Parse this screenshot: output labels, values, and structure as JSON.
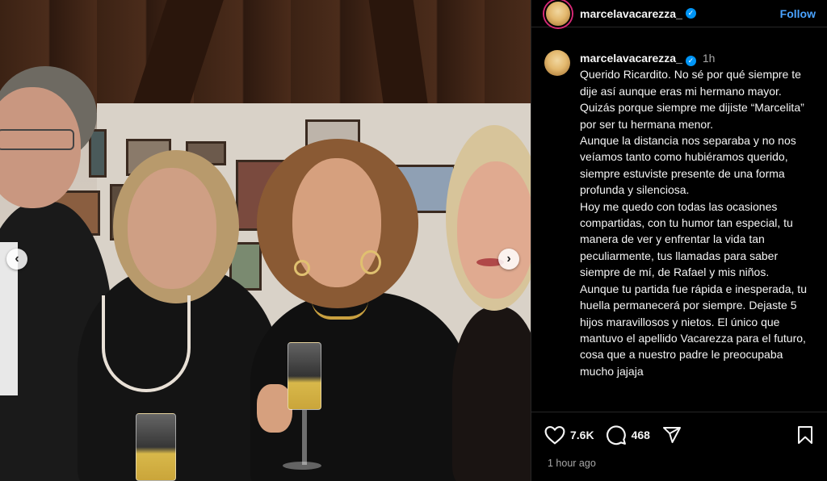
{
  "post": {
    "username": "marcelavacarezza_",
    "follow_label": "Follow",
    "verified_icon": "verified-badge-icon"
  },
  "caption": {
    "username": "marcelavacarezza_",
    "time": "1h",
    "paragraphs": [
      "Querido Ricardito. No sé por qué siempre te dije así aunque eras mi hermano mayor. Quizás porque siempre me dijiste “Marcelita” por ser tu hermana menor.",
      "Aunque la distancia nos separaba y no nos veíamos tanto como hubiéramos querido, siempre estuviste presente de una forma profunda y silenciosa.",
      "Hoy me quedo con todas las ocasiones compartidas, con tu humor tan especial, tu manera de ver y enfrentar la vida tan peculiarmente, tus llamadas para saber siempre de mí, de Rafael y mis niños.",
      "Aunque tu partida fue rápida e inesperada, tu huella permanecerá por siempre. Dejaste 5 hijos maravillosos y nietos. El único que mantuvo el apellido Vacarezza para el futuro, cosa que a nuestro padre le preocupaba mucho jajaja"
    ]
  },
  "actions": {
    "likes": "7.6K",
    "comments": "468",
    "posted": "1 hour ago"
  },
  "carousel": {
    "prev_icon": "‹",
    "next_icon": "›"
  }
}
